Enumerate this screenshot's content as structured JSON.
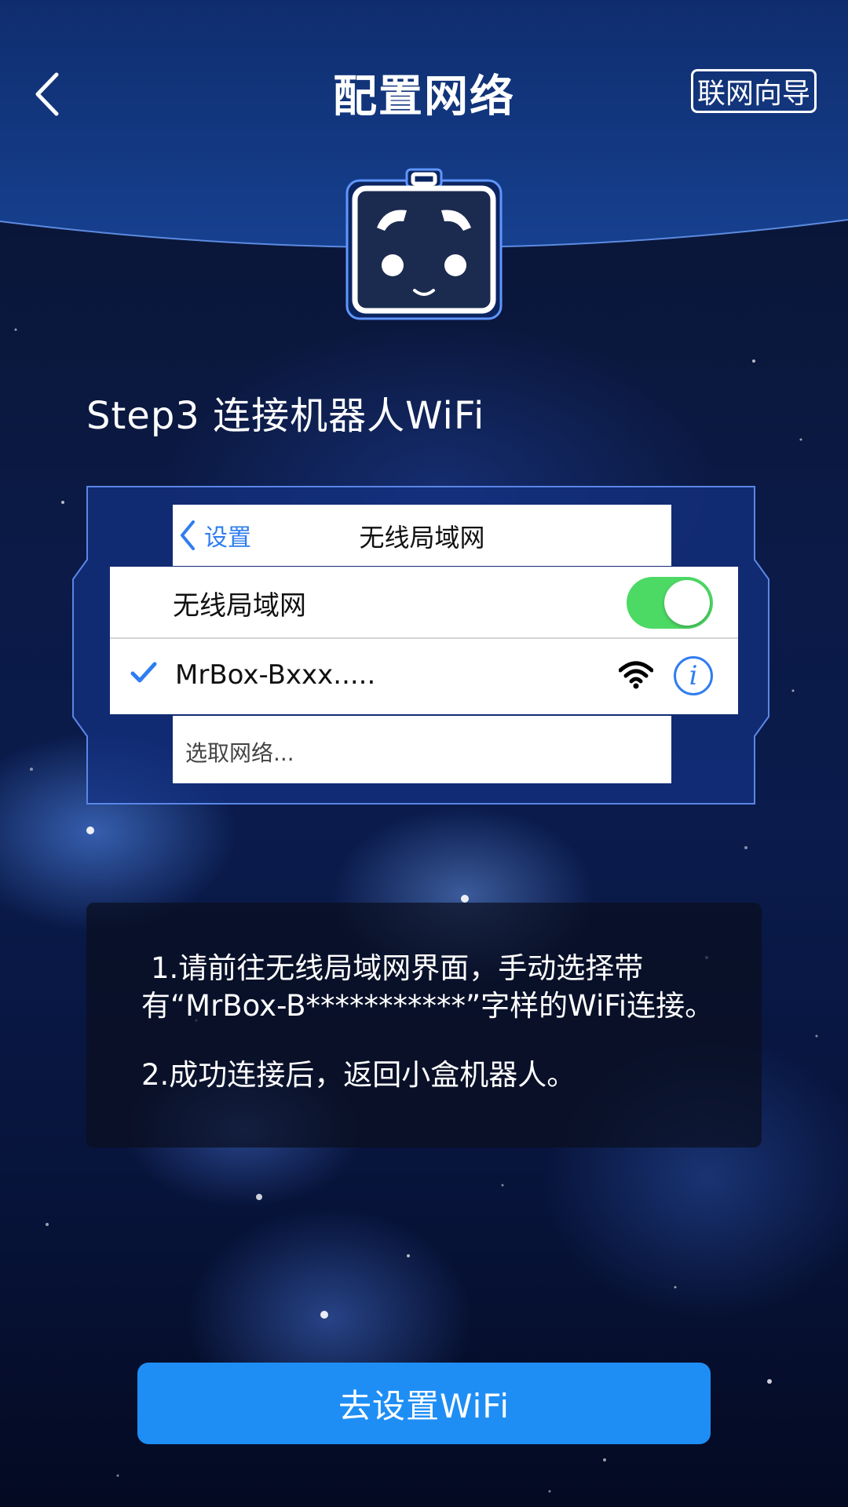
{
  "header": {
    "title": "配置网络",
    "guide_button": "联网向导"
  },
  "step": {
    "title": "Step3 连接机器人WiFi"
  },
  "settings_mock": {
    "back_label": "设置",
    "title": "无线局域网",
    "wlan_label": "无线局域网",
    "wlan_enabled": true,
    "network_name": "MrBox-Bxxx.....",
    "info_icon_text": "i",
    "choose_network": "选取网络..."
  },
  "instructions": {
    "line1": "1.请前往无线局域网界面，手动选择带有“MrBox-B***********”字样的WiFi连接。",
    "line2": "2.成功连接后，返回小盒机器人。"
  },
  "cta": {
    "label": "去设置WiFi"
  },
  "colors": {
    "accent": "#1e8ef5",
    "ios_blue": "#2f7df0",
    "toggle_on": "#4cd964"
  },
  "icons": [
    "back-arrow-icon",
    "robot-logo",
    "chevron-left-icon",
    "checkmark-icon",
    "wifi-icon",
    "info-icon"
  ]
}
